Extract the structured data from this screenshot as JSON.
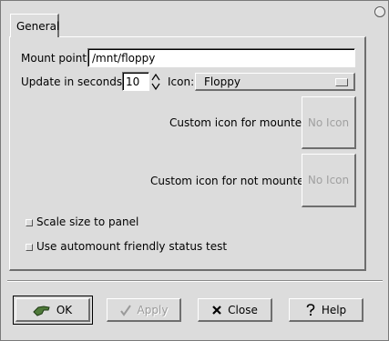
{
  "tabs": [
    {
      "label": "General"
    }
  ],
  "general": {
    "mount_point_label": "Mount point:",
    "mount_point_value": "/mnt/floppy",
    "update_label": "Update in seconds:",
    "update_value": "10",
    "icon_label": "Icon:",
    "icon_selected": "Floppy",
    "custom_mounted_label": "Custom icon for mounted:",
    "custom_mounted_button": "No Icon",
    "custom_unmounted_label": "Custom icon for not mounted:",
    "custom_unmounted_button": "No Icon",
    "scale_label": "Scale size to panel",
    "scale_checked": false,
    "automount_label": "Use automount friendly status test",
    "automount_checked": false
  },
  "buttons": {
    "ok": "OK",
    "apply": "Apply",
    "close": "Close",
    "help": "Help"
  },
  "icons": {
    "ok": "ok-hand-icon",
    "apply": "checkmark-icon",
    "close": "x-icon",
    "help": "question-mark-icon",
    "spin": "spin-arrows-icon",
    "option": "option-indicator-icon"
  },
  "colors": {
    "background": "#dcdcdc",
    "entry_background": "#ffffff",
    "disabled_text": "#9a9a9a",
    "ok_icon": "#4f7a3a"
  }
}
